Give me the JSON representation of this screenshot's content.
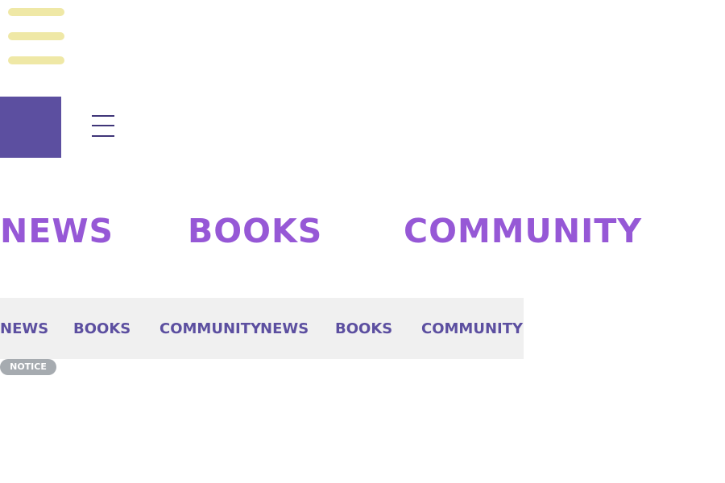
{
  "top_menu": {
    "icon": "hamburger-menu-icon",
    "color": "#efe8a6"
  },
  "search": {
    "icon": "search-icon",
    "background": "#5c4fa0"
  },
  "nav_menu": {
    "icon": "hamburger-menu-icon",
    "color": "#3f3578"
  },
  "big_nav": {
    "color": "#9658d6",
    "items": [
      {
        "label": "NEWS"
      },
      {
        "label": "BOOKS"
      },
      {
        "label": "COMMUNITY"
      }
    ]
  },
  "ticker": {
    "color": "#5c4fa0",
    "background": "#f0f0f0",
    "items": [
      {
        "label": "NEWS"
      },
      {
        "label": "BOOKS"
      },
      {
        "label": "COMMUNITY"
      },
      {
        "label": "NEWS"
      },
      {
        "label": "BOOKS"
      },
      {
        "label": "COMMUNITY"
      }
    ]
  },
  "notice": {
    "label": "NOTICE",
    "background": "#a6abb0"
  }
}
